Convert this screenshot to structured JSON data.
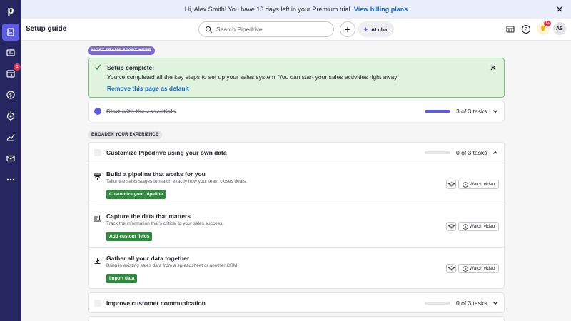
{
  "rail": {
    "logo": "p",
    "items": [
      {
        "name": "setup-guide",
        "icon": "clipboard-icon",
        "active": true
      },
      {
        "name": "leads",
        "icon": "leads-inbox-icon"
      },
      {
        "name": "activities",
        "icon": "calendar-icon",
        "badge": "1"
      },
      {
        "name": "deals",
        "icon": "dollar-icon"
      },
      {
        "name": "projects",
        "icon": "target-icon"
      },
      {
        "name": "insights",
        "icon": "chart-icon"
      },
      {
        "name": "mail",
        "icon": "mail-icon"
      },
      {
        "name": "more",
        "icon": "more-icon"
      }
    ]
  },
  "banner": {
    "text": "Hi, Alex Smith! You have 13 days left in your Premium trial.",
    "link": "View billing plans"
  },
  "header": {
    "title": "Setup guide",
    "search_placeholder": "Search Pipedrive",
    "plus": "+",
    "ai_label": "AI chat",
    "bulb_badge": "1+",
    "avatar": "AS"
  },
  "main": {
    "most_teams_pill": "MOST TEAMS START HERE",
    "success": {
      "title": "Setup complete!",
      "message": "You’ve completed all the key steps to set up your sales system. You can start your sales activities right away!",
      "link": "Remove this page as default"
    },
    "essentials": {
      "title": "Start with the essentials",
      "count": "3 of 3 tasks",
      "progress": 1.0
    },
    "broaden_pill": "BROADEN YOUR EXPERIENCE",
    "customize": {
      "title": "Customize Pipedrive using your own data",
      "count": "0 of 3 tasks",
      "progress": 0,
      "tasks": [
        {
          "title": "Build a pipeline that works for you",
          "desc": "Tailor the sales stages to match exactly how your team closes deals.",
          "button": "Customize your pipeline",
          "video": "Watch video"
        },
        {
          "title": "Capture the data that matters",
          "desc": "Track the information that’s critical to your sales success.",
          "button": "Add custom fields",
          "video": "Watch video"
        },
        {
          "title": "Gather all your data together",
          "desc": "Bring in existing sales data from a spreadsheet or another CRM.",
          "button": "Import data",
          "video": "Watch video"
        }
      ]
    },
    "communication": {
      "title": "Improve customer communication",
      "count": "0 of 3 tasks",
      "progress": 0
    }
  }
}
